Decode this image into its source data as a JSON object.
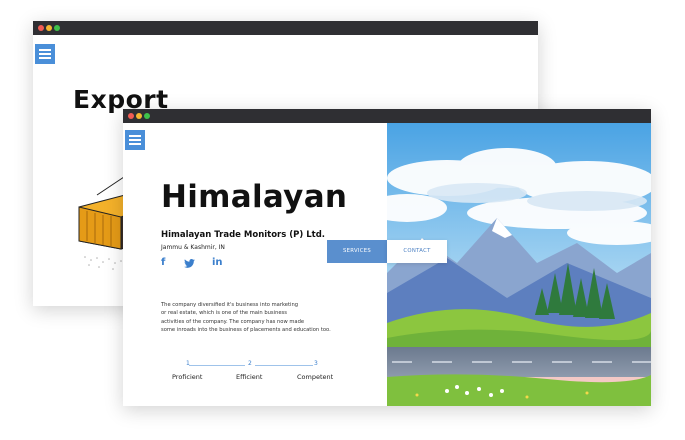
{
  "back_window": {
    "heading": "Export"
  },
  "front_window": {
    "hero_title": "Himalayan",
    "company_name": "Himalayan Trade Monitors (P) Ltd.",
    "location": "Jammu & Kashmir, IN",
    "social": {
      "facebook": "f",
      "twitter": "t",
      "linkedin": "in"
    },
    "description": [
      "The company diversified it's business into marketing",
      "or real estate, which is one of the main business",
      "activities of the company. The company has now made",
      "some inroads into the business of placements and education too."
    ],
    "buttons": {
      "services": "SERVICES",
      "contact": "CONTACT"
    },
    "steps": [
      {
        "number": "1",
        "label": "Proficient"
      },
      {
        "number": "2",
        "label": "Efficient"
      },
      {
        "number": "3",
        "label": "Competent"
      }
    ]
  },
  "colors": {
    "titlebar": "#2f2f33",
    "accent_blue": "#4a8fd9",
    "dot_red": "#f25c54",
    "dot_yellow": "#f5b731",
    "dot_green": "#3fc24a"
  },
  "icons": [
    "menu-icon",
    "facebook-icon",
    "twitter-icon",
    "linkedin-icon",
    "cargo-container-illustration",
    "mountain-landscape-illustration"
  ]
}
